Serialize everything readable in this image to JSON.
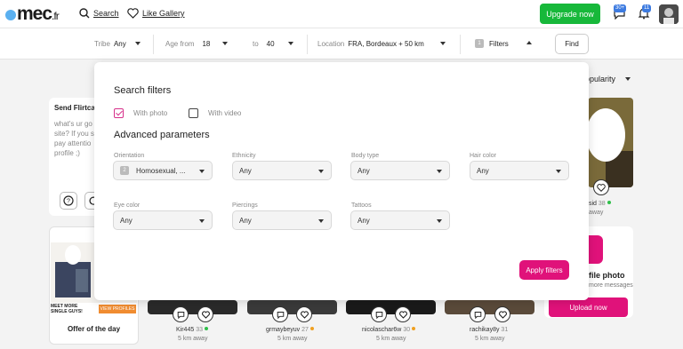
{
  "header": {
    "logo_main": "mec",
    "logo_tld": ".fr",
    "search_label": "Search",
    "gallery_label": "Like Gallery",
    "upgrade_label": "Upgrade now",
    "messages_badge": "30+",
    "notifications_badge": "11"
  },
  "filters": {
    "tribe_label": "Tribe",
    "tribe_value": "Any",
    "age_from_label": "Age from",
    "age_from_value": "18",
    "age_to_label": "to",
    "age_to_value": "40",
    "location_label": "Location",
    "location_value": "FRA, Bordeaux + 50 km",
    "filters_count": "1",
    "filters_label": "Filters",
    "find_label": "Find"
  },
  "background": {
    "flirt_title": "Send Flirtca",
    "flirt_text": "what's ur go site? If you s pay attentio profile ;)",
    "sort_label": "opularity",
    "offer_banner": "MEET MORE SINGLE GUYS!",
    "offer_btn": "VIEW PROFILES",
    "offer_label": "Offer of the day",
    "profiles": [
      {
        "name": "Kir445",
        "age": "33",
        "away": "5 km away"
      },
      {
        "name": "grmaybeyuv",
        "age": "27",
        "away": "5 km away"
      },
      {
        "name": "nicolaschar6w",
        "age": "30",
        "away": "5 km away"
      },
      {
        "name": "rachikay8y",
        "age": "31",
        "away": "5 km away"
      }
    ],
    "right_profile_name": "sid",
    "right_profile_age": "38",
    "right_profile_away": "away",
    "profile_photo_title": "file photo",
    "profile_photo_sub": "more messages",
    "upload_label": "Upload now",
    "colors": {
      "online": "#2fbf4a",
      "away": "#f0a020",
      "accent": "#e0127a",
      "green": "#17b83a"
    }
  },
  "modal": {
    "title": "Search filters",
    "with_photo_label": "With photo",
    "with_photo_checked": true,
    "with_video_label": "With video",
    "with_video_checked": false,
    "advanced_title": "Advanced parameters",
    "fields": [
      {
        "label": "Orientation",
        "value": "Homosexual, ...",
        "count": "2"
      },
      {
        "label": "Ethnicity",
        "value": "Any"
      },
      {
        "label": "Body type",
        "value": "Any"
      },
      {
        "label": "Hair color",
        "value": "Any"
      },
      {
        "label": "Eye color",
        "value": "Any"
      },
      {
        "label": "Piercings",
        "value": "Any"
      },
      {
        "label": "Tattoos",
        "value": "Any"
      }
    ],
    "apply_label": "Apply filters"
  }
}
